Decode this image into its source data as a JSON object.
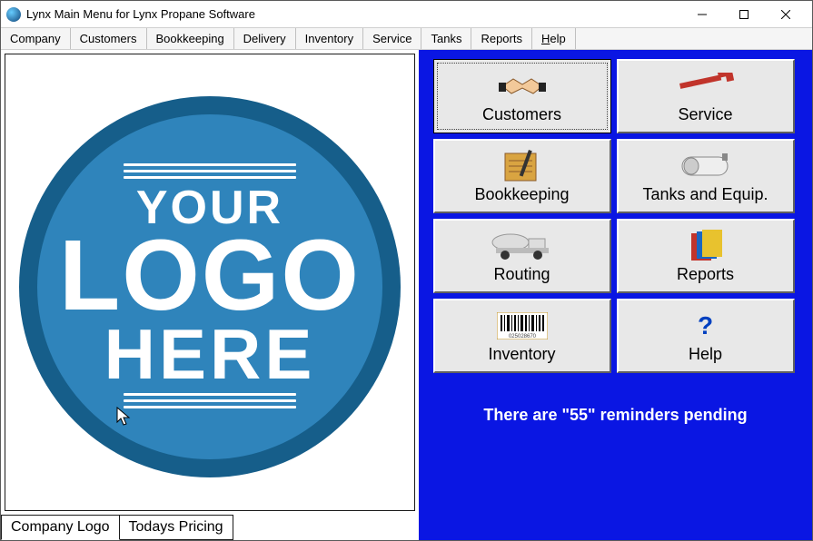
{
  "window": {
    "title": "Lynx Main Menu for Lynx Propane Software"
  },
  "menubar": {
    "items": [
      "Company",
      "Customers",
      "Bookkeeping",
      "Delivery",
      "Inventory",
      "Service",
      "Tanks",
      "Reports",
      "Help"
    ],
    "underline_first_of": "Help"
  },
  "logo": {
    "line1": "YOUR",
    "line2": "LOGO",
    "line3": "HERE"
  },
  "tabs": {
    "logo": "Company Logo",
    "pricing": "Todays Pricing",
    "active": "logo"
  },
  "buttons": {
    "customers": "Customers",
    "service": "Service",
    "bookkeeping": "Bookkeeping",
    "tanks": "Tanks and Equip.",
    "routing": "Routing",
    "reports": "Reports",
    "inventory": "Inventory",
    "help": "Help"
  },
  "reminders": {
    "prefix": "There are \"",
    "count": "55",
    "suffix": "\" reminders pending"
  }
}
